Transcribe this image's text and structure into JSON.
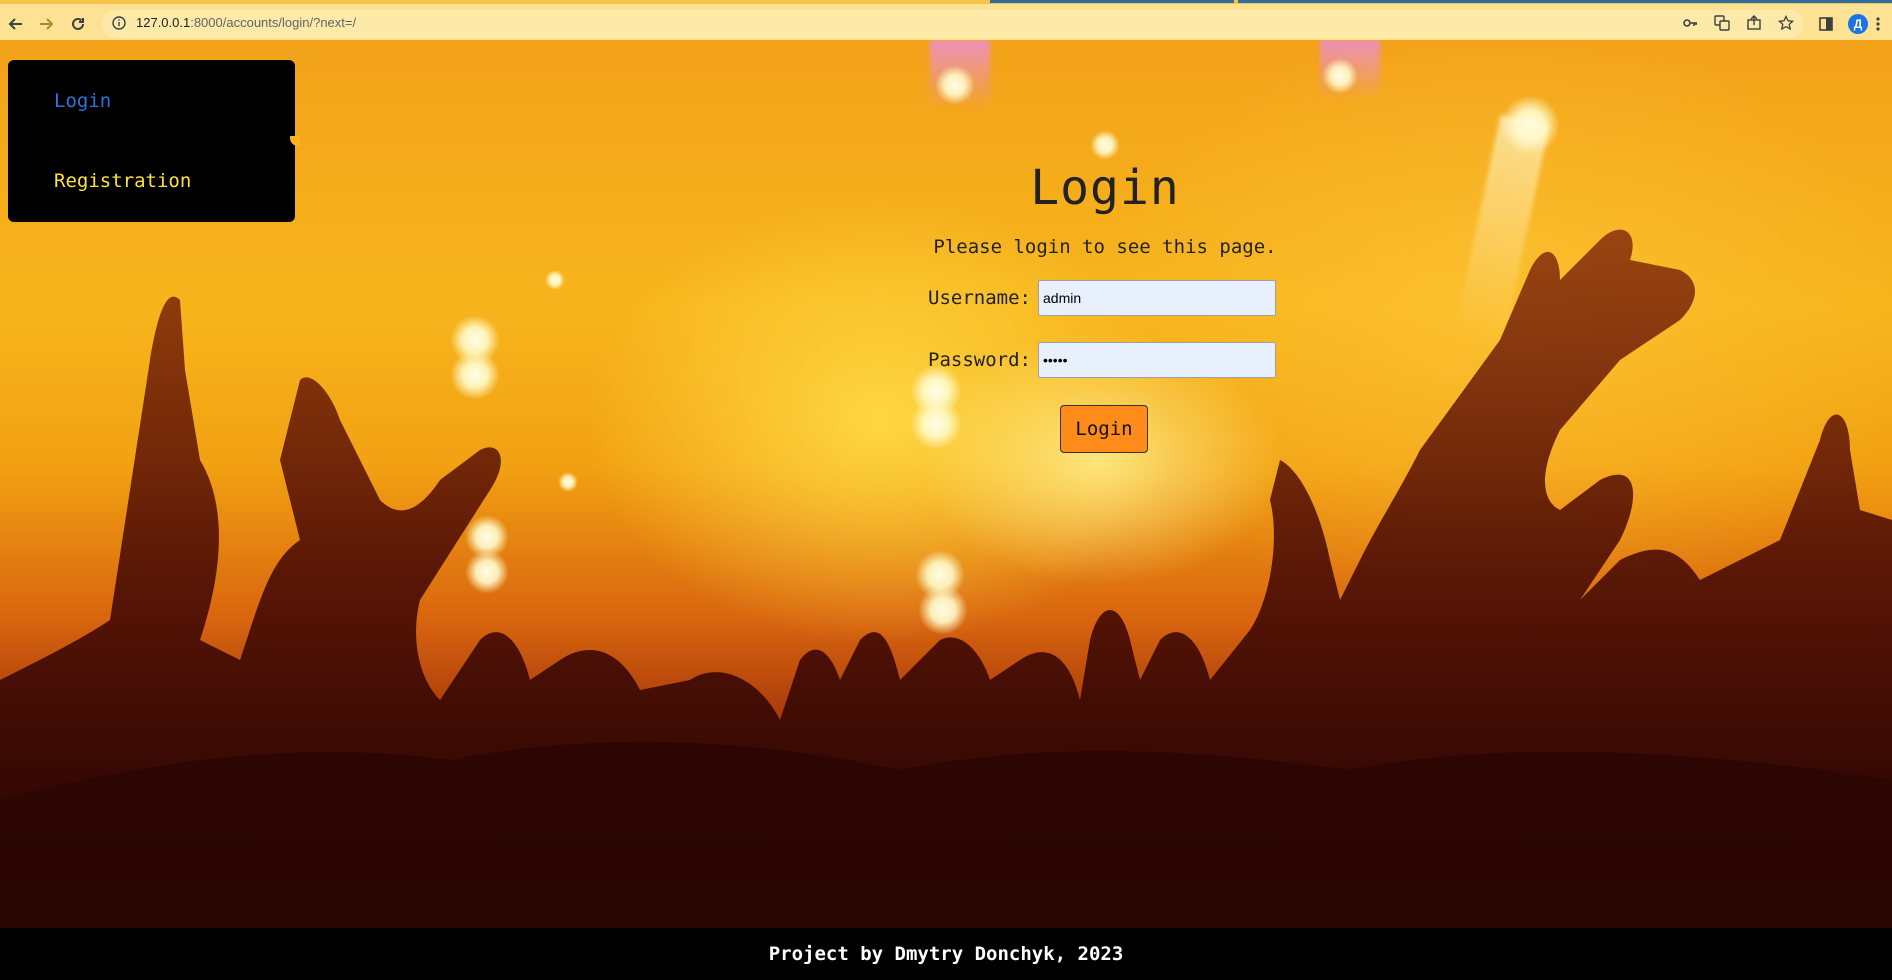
{
  "browser": {
    "url_host": "127.0.0.1",
    "url_rest": ":8000/accounts/login/?next=/",
    "profile_initial": "Д",
    "icons": [
      "back-arrow-icon",
      "forward-arrow-icon",
      "reload-icon",
      "info-icon",
      "key-icon",
      "translate-icon",
      "share-icon",
      "star-icon",
      "sidebar-panel-icon",
      "menu-icon"
    ]
  },
  "sidebar": {
    "items": [
      {
        "label": "Login"
      },
      {
        "label": "Registration"
      }
    ],
    "colors": {
      "active": "#2d73d6",
      "link": "#ffe23a"
    }
  },
  "form": {
    "title": "Login",
    "subtitle": "Please login to see this page.",
    "username_label": "Username:",
    "username_value": "admin",
    "password_label": "Password:",
    "password_value": "•••••",
    "submit_label": "Login",
    "submit_color": "#ff8c1a"
  },
  "footer": {
    "text": "Project by Dmytry Donchyk, 2023"
  }
}
